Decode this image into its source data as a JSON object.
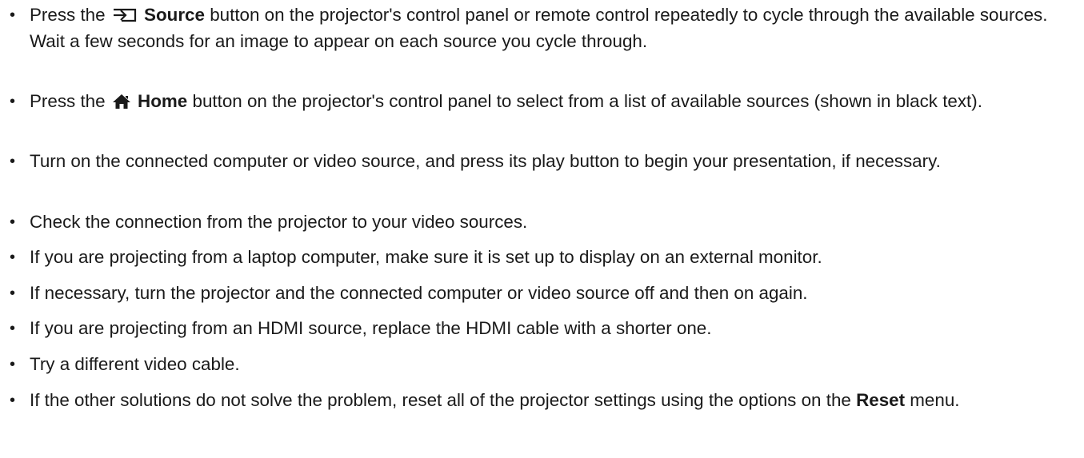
{
  "items": [
    {
      "pre": "Press the ",
      "icon": "source-icon",
      "bold": "Source",
      "post": " button on the projector's control panel or remote control repeatedly to cycle through the available sources. Wait a few seconds for an image to appear on each source you cycle through."
    },
    {
      "pre": "Press the ",
      "icon": "home-icon",
      "bold": "Home",
      "post": " button on the projector's control panel to select from a list of available sources (shown in black text)."
    },
    {
      "text": "Turn on the connected computer or video source, and press its play button to begin your presentation, if necessary."
    },
    {
      "text": "Check the connection from the projector to your video sources."
    },
    {
      "text": "If you are projecting from a laptop computer, make sure it is set up to display on an external monitor."
    },
    {
      "text": "If necessary, turn the projector and the connected computer or video source off and then on again."
    },
    {
      "text": "If you are projecting from an HDMI source, replace the HDMI cable with a shorter one."
    },
    {
      "text": "Try a different video cable."
    },
    {
      "pre": "If the other solutions do not solve the problem, reset all of the projector settings using the options on the ",
      "bold": "Reset",
      "post": " menu."
    }
  ],
  "bullet": "•"
}
